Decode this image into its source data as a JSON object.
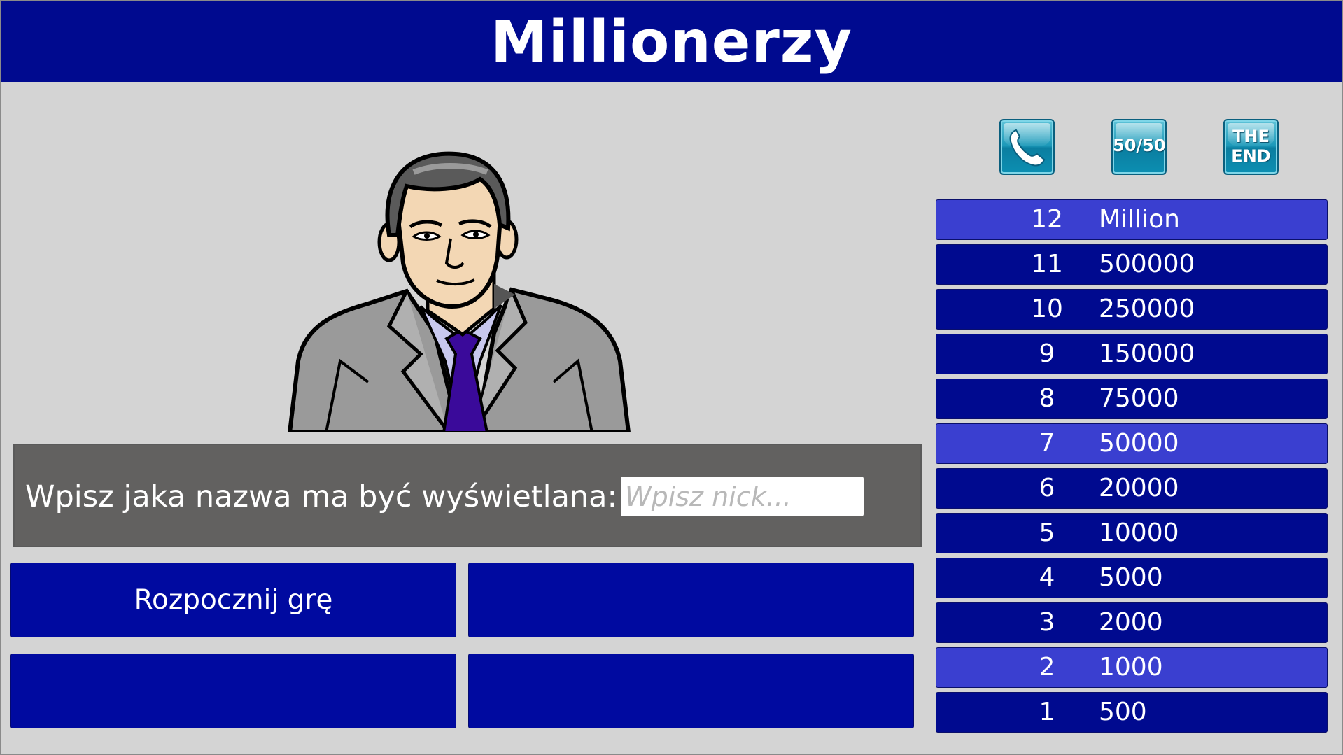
{
  "header": {
    "title": "Millionerzy"
  },
  "nick_panel": {
    "label": "Wpisz jaka nazwa ma być wyświetlana:",
    "input_value": "",
    "input_placeholder": "Wpisz nick..."
  },
  "answers": [
    {
      "label": "Rozpocznij grę"
    },
    {
      "label": ""
    },
    {
      "label": ""
    },
    {
      "label": ""
    }
  ],
  "lifelines": [
    {
      "icon": "phone-a-friend-icon",
      "label": ""
    },
    {
      "icon": "fifty-fifty-icon",
      "label": "50/50"
    },
    {
      "icon": "the-end-icon",
      "label_line1": "THE",
      "label_line2": "END"
    }
  ],
  "ladder": [
    {
      "level": "12",
      "amount": "Million",
      "highlight": true
    },
    {
      "level": "11",
      "amount": "500000",
      "highlight": false
    },
    {
      "level": "10",
      "amount": "250000",
      "highlight": false
    },
    {
      "level": "9",
      "amount": "150000",
      "highlight": false
    },
    {
      "level": "8",
      "amount": "75000",
      "highlight": false
    },
    {
      "level": "7",
      "amount": "50000",
      "highlight": true
    },
    {
      "level": "6",
      "amount": "20000",
      "highlight": false
    },
    {
      "level": "5",
      "amount": "10000",
      "highlight": false
    },
    {
      "level": "4",
      "amount": "5000",
      "highlight": false
    },
    {
      "level": "3",
      "amount": "2000",
      "highlight": false
    },
    {
      "level": "2",
      "amount": "1000",
      "highlight": true
    },
    {
      "level": "1",
      "amount": "500",
      "highlight": false
    }
  ],
  "colors": {
    "header_bg": "#000a8f",
    "page_bg": "#d4d4d4",
    "panel_bg": "#626160",
    "button_bg": "#000aa0",
    "ladder_bg": "#000a8f",
    "ladder_highlight": "#3a3fd0",
    "lifeline_accent": "#1b98b8"
  }
}
